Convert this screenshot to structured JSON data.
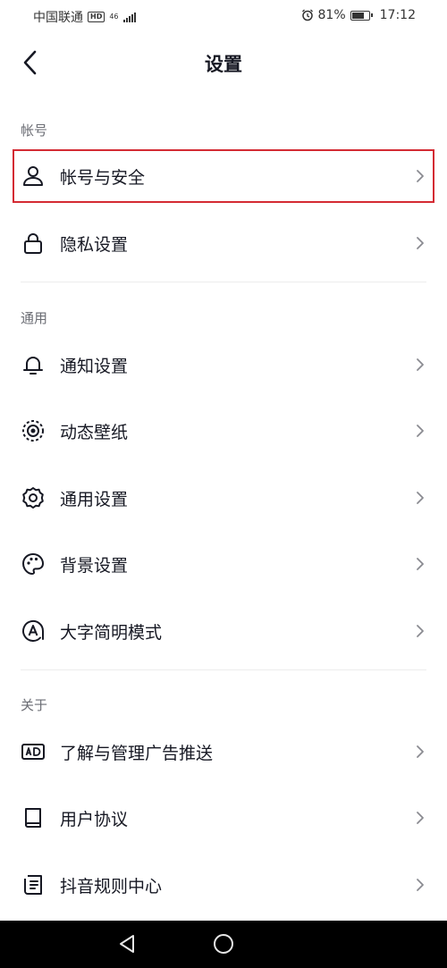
{
  "status_bar": {
    "carrier": "中国联通",
    "hd_badge": "HD",
    "network": "46",
    "battery_percent": "81%",
    "battery_level": 0.81,
    "time": "17:12"
  },
  "nav": {
    "title": "设置"
  },
  "sections": {
    "account": {
      "header": "帐号",
      "items": [
        {
          "label": "帐号与安全",
          "icon": "user-icon"
        },
        {
          "label": "隐私设置",
          "icon": "lock-icon"
        }
      ]
    },
    "general": {
      "header": "通用",
      "items": [
        {
          "label": "通知设置",
          "icon": "bell-icon"
        },
        {
          "label": "动态壁纸",
          "icon": "live-wallpaper-icon"
        },
        {
          "label": "通用设置",
          "icon": "gear-icon"
        },
        {
          "label": "背景设置",
          "icon": "palette-icon"
        },
        {
          "label": "大字简明模式",
          "icon": "large-text-icon"
        }
      ]
    },
    "about": {
      "header": "关于",
      "items": [
        {
          "label": "了解与管理广告推送",
          "icon": "ad-icon"
        },
        {
          "label": "用户协议",
          "icon": "book-icon"
        },
        {
          "label": "抖音规则中心",
          "icon": "rules-document-icon"
        }
      ]
    }
  },
  "colors": {
    "highlight_border": "#d42a33",
    "text_primary": "#161823",
    "text_secondary": "#6b6d74",
    "divider": "#ededed"
  }
}
